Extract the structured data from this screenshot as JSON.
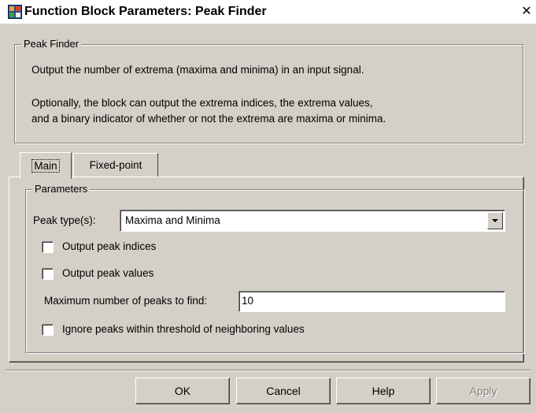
{
  "window": {
    "title": "Function Block Parameters: Peak Finder",
    "close_glyph": "✕"
  },
  "block_group": {
    "legend": "Peak Finder",
    "description_line1": "Output the number of extrema (maxima and minima) in an input signal.",
    "description_line2": "Optionally, the block can output the extrema indices, the extrema values,",
    "description_line3": "and a binary indicator of whether or not the extrema are maxima or minima."
  },
  "tabs": [
    {
      "label": "Main",
      "selected": true
    },
    {
      "label": "Fixed-point",
      "selected": false
    }
  ],
  "parameters": {
    "legend": "Parameters",
    "peak_type_label": "Peak type(s):",
    "peak_type_value": "Maxima and Minima",
    "output_indices_label": "Output peak indices",
    "output_values_label": "Output peak values",
    "max_peaks_label": "Maximum number of peaks to find:",
    "max_peaks_value": "10",
    "ignore_threshold_label": "Ignore peaks within threshold of neighboring values"
  },
  "buttons": {
    "ok": "OK",
    "cancel": "Cancel",
    "help": "Help",
    "apply": "Apply"
  },
  "colors": {
    "face": "#d4d0c8",
    "titlebar": "#ffffff",
    "disabled_text": "#808080"
  }
}
